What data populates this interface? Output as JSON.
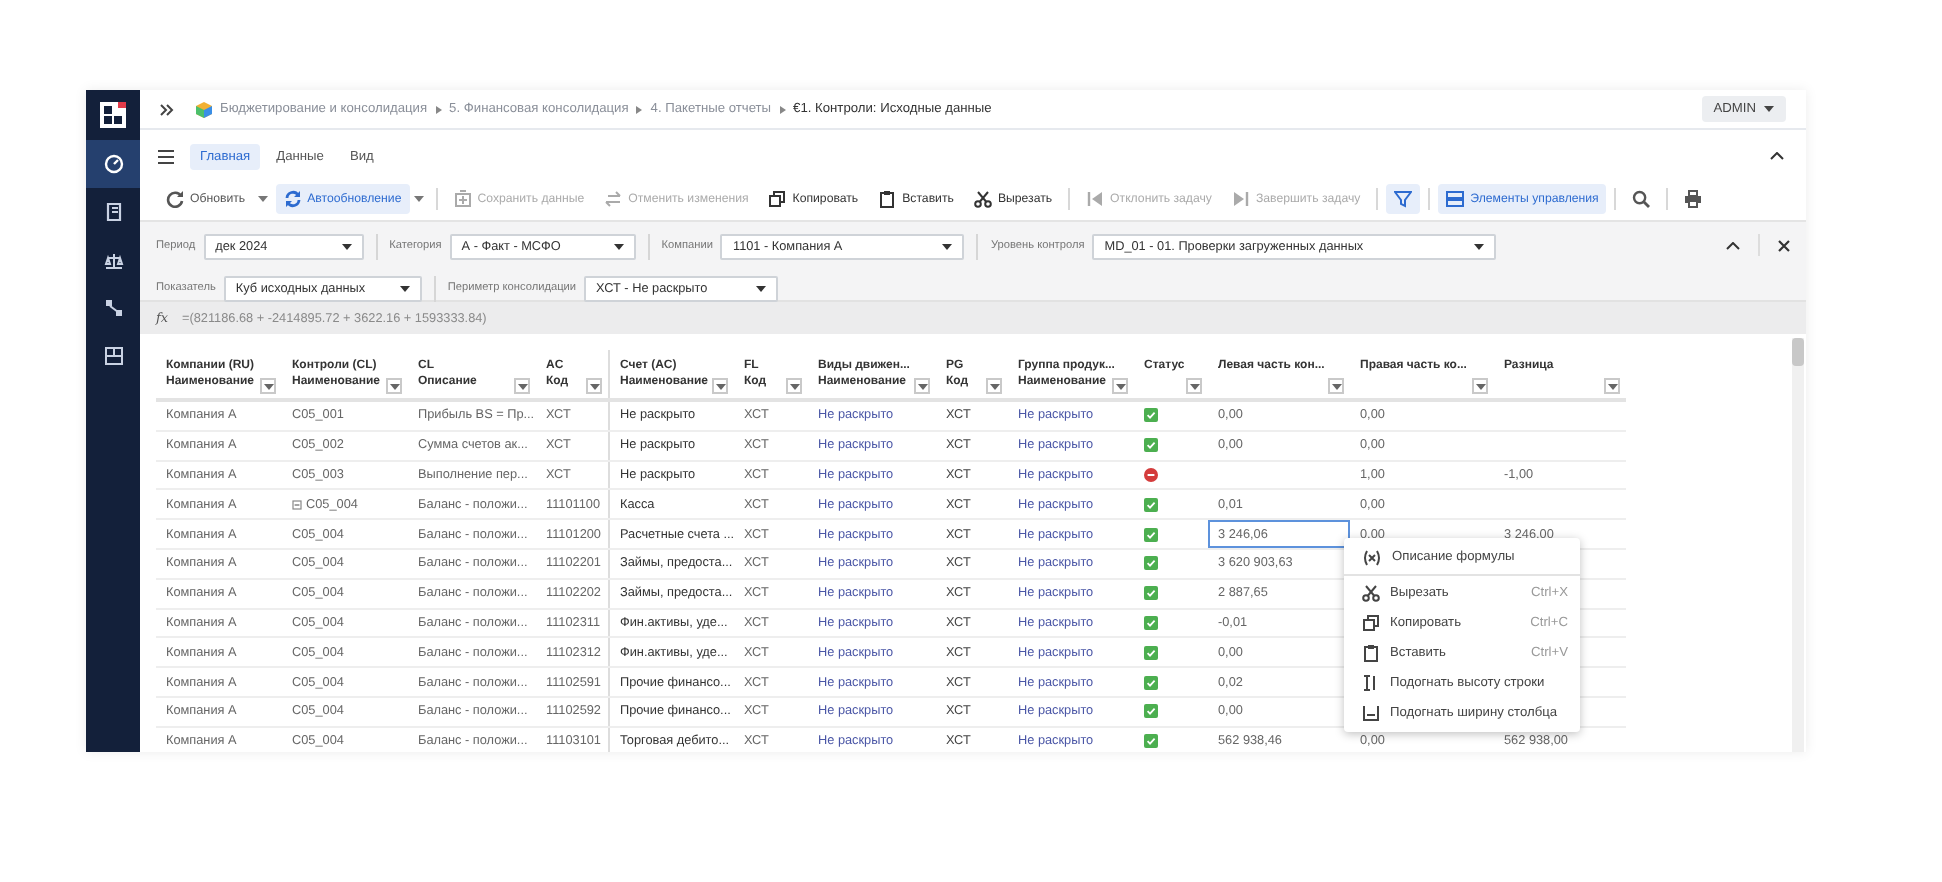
{
  "sidebar": {
    "items": [
      {
        "kind": "gauge",
        "selected": true
      },
      {
        "kind": "book",
        "selected": false
      },
      {
        "kind": "scale",
        "selected": false
      },
      {
        "kind": "network",
        "selected": false
      },
      {
        "kind": "dashboard",
        "selected": false
      }
    ]
  },
  "breadcrumb": [
    {
      "label": "Бюджетирование и консолидация",
      "current": false
    },
    {
      "label": "5. Финансовая консолидация",
      "current": false
    },
    {
      "label": "4. Пакетные отчеты",
      "current": false
    },
    {
      "label": "€1. Контроли: Исходные данные",
      "current": true
    }
  ],
  "user_menu": {
    "label": "ADMIN"
  },
  "ribbon_tabs": [
    {
      "label": "Главная",
      "selected": true
    },
    {
      "label": "Данные",
      "selected": false
    },
    {
      "label": "Вид",
      "selected": false
    }
  ],
  "toolbar": [
    {
      "kind": "refresh",
      "label": "Обновить",
      "dropdown": true,
      "active": false,
      "disabled": false
    },
    {
      "kind": "sync",
      "label": "Автообновление",
      "dropdown": true,
      "active": true,
      "disabled": false
    },
    {
      "kind": "separator"
    },
    {
      "kind": "save",
      "label": "Сохранить данные",
      "dropdown": false,
      "active": false,
      "disabled": true
    },
    {
      "kind": "undo",
      "label": "Отменить изменения",
      "dropdown": false,
      "active": false,
      "disabled": true
    },
    {
      "kind": "copy",
      "label": "Копировать",
      "dropdown": false,
      "active": false,
      "disabled": false
    },
    {
      "kind": "paste",
      "label": "Вставить",
      "dropdown": false,
      "active": false,
      "disabled": false
    },
    {
      "kind": "cut",
      "label": "Вырезать",
      "dropdown": false,
      "active": false,
      "disabled": false
    },
    {
      "kind": "separator"
    },
    {
      "kind": "reject",
      "label": "Отклонить задачу",
      "dropdown": false,
      "active": false,
      "disabled": true
    },
    {
      "kind": "complete",
      "label": "Завершить задачу",
      "dropdown": false,
      "active": false,
      "disabled": true
    },
    {
      "kind": "separator"
    },
    {
      "kind": "filter",
      "dropdown": false,
      "active": true,
      "disabled": false
    },
    {
      "kind": "separator"
    },
    {
      "kind": "controls",
      "label": "Элементы управления",
      "dropdown": false,
      "active": true,
      "disabled": false
    },
    {
      "kind": "separator"
    },
    {
      "kind": "search",
      "dropdown": false,
      "active": false,
      "disabled": false
    },
    {
      "kind": "separator"
    },
    {
      "kind": "print",
      "dropdown": false,
      "active": false,
      "disabled": false
    }
  ],
  "filters": [
    [
      {
        "label": "Период",
        "value": "дек 2024"
      },
      {
        "label": "Категория",
        "value": "А - Факт - МСФО"
      },
      {
        "label": "Компании",
        "value": "1101 - Компания А"
      },
      {
        "label": "Уровень контроля",
        "value": "MD_01 - 01. Проверки загруженных данных"
      }
    ],
    [
      {
        "label": "Показатель",
        "value": "Куб исходных данных"
      },
      {
        "label": "Периметр консолидации",
        "value": "ХСТ - Не раскрыто"
      }
    ]
  ],
  "formula": {
    "label": "fx",
    "value": "=(821186.68 + -2414895.72 + 3622.16 + 1593333.84)"
  },
  "table": {
    "columns": [
      {
        "label": "Компании (RU)\nНаименование",
        "kind": "text"
      },
      {
        "label": "Контроли (CL)\nНаименование",
        "kind": "text"
      },
      {
        "label": "CL\nОписание",
        "kind": "text"
      },
      {
        "label": "AC\nКод",
        "kind": "text"
      },
      {
        "label": "Счет (AC)\nНаименование",
        "kind": "account"
      },
      {
        "label": "FL\nКод",
        "kind": "text"
      },
      {
        "label": "Виды движен...\nНаименование",
        "kind": "link"
      },
      {
        "label": "PG\nКод",
        "kind": "code"
      },
      {
        "label": "Группа продук...\nНаименование",
        "kind": "link"
      },
      {
        "label": "Статус",
        "kind": "status"
      },
      {
        "label": "Левая часть кон...",
        "kind": "amount"
      },
      {
        "label": "Правая часть ко...",
        "kind": "amount"
      },
      {
        "label": "Разница",
        "kind": "amount"
      }
    ],
    "rows": [
      {
        "selected": false,
        "status_ok": true,
        "cells": [
          "Компания А",
          "C05_001",
          "Прибыль BS = Пр...",
          "ХСТ",
          "Не раскрыто",
          "ХСТ",
          "Не раскрыто",
          "ХСТ",
          "Не раскрыто",
          null,
          "0,00",
          "0,00",
          null
        ]
      },
      {
        "selected": false,
        "status_ok": true,
        "cells": [
          "Компания А",
          "C05_002",
          "Сумма счетов ак...",
          "ХСТ",
          "Не раскрыто",
          "ХСТ",
          "Не раскрыто",
          "ХСТ",
          "Не раскрыто",
          null,
          "0,00",
          "0,00",
          null
        ]
      },
      {
        "selected": false,
        "status_ok": false,
        "cells": [
          "Компания А",
          "C05_003",
          "Выполнение пер...",
          "ХСТ",
          "Не раскрыто",
          "ХСТ",
          "Не раскрыто",
          "ХСТ",
          "Не раскрыто",
          null,
          null,
          "1,00",
          "-1,00"
        ]
      },
      {
        "selected": false,
        "status_ok": true,
        "expanded": true,
        "cells": [
          "Компания А",
          "C05_004",
          "Баланс - положи...",
          "11101100",
          "Касса",
          "ХСТ",
          "Не раскрыто",
          "ХСТ",
          "Не раскрыто",
          null,
          "0,01",
          "0,00",
          null
        ]
      },
      {
        "selected": true,
        "status_ok": true,
        "cells": [
          "Компания А",
          "C05_004",
          "Баланс - положи...",
          "11101200",
          "Расчетные счета ...",
          "ХСТ",
          "Не раскрыто",
          "ХСТ",
          "Не раскрыто",
          null,
          "3 246,06",
          "0,00",
          "3 246,00"
        ]
      },
      {
        "selected": false,
        "status_ok": true,
        "cells": [
          "Компания А",
          "C05_004",
          "Баланс - положи...",
          "11102201",
          "Займы, предоста...",
          "ХСТ",
          "Не раскрыто",
          "ХСТ",
          "Не раскрыто",
          null,
          "3 620 903,63",
          null,
          null
        ]
      },
      {
        "selected": false,
        "status_ok": true,
        "cells": [
          "Компания А",
          "C05_004",
          "Баланс - положи...",
          "11102202",
          "Займы, предоста...",
          "ХСТ",
          "Не раскрыто",
          "ХСТ",
          "Не раскрыто",
          null,
          "2 887,65",
          null,
          null
        ]
      },
      {
        "selected": false,
        "status_ok": true,
        "cells": [
          "Компания А",
          "C05_004",
          "Баланс - положи...",
          "11102311",
          "Фин.активы, уде...",
          "ХСТ",
          "Не раскрыто",
          "ХСТ",
          "Не раскрыто",
          null,
          "-0,01",
          null,
          null
        ]
      },
      {
        "selected": false,
        "status_ok": true,
        "cells": [
          "Компания А",
          "C05_004",
          "Баланс - положи...",
          "11102312",
          "Фин.активы, уде...",
          "ХСТ",
          "Не раскрыто",
          "ХСТ",
          "Не раскрыто",
          null,
          "0,00",
          null,
          null
        ]
      },
      {
        "selected": false,
        "status_ok": true,
        "cells": [
          "Компания А",
          "C05_004",
          "Баланс - положи...",
          "11102591",
          "Прочие финансо...",
          "ХСТ",
          "Не раскрыто",
          "ХСТ",
          "Не раскрыто",
          null,
          "0,02",
          null,
          null
        ]
      },
      {
        "selected": false,
        "status_ok": true,
        "cells": [
          "Компания А",
          "C05_004",
          "Баланс - положи...",
          "11102592",
          "Прочие финансо...",
          "ХСТ",
          "Не раскрыто",
          "ХСТ",
          "Не раскрыто",
          null,
          "0,00",
          null,
          null
        ]
      },
      {
        "selected": false,
        "status_ok": true,
        "cells": [
          "Компания А",
          "C05_004",
          "Баланс - положи...",
          "11103101",
          "Торговая дебито...",
          "ХСТ",
          "Не раскрыто",
          "ХСТ",
          "Не раскрыто",
          null,
          "562 938,46",
          "0,00",
          "562 938,00"
        ]
      }
    ]
  },
  "context_menu": [
    {
      "kind": "formula",
      "label": "Описание формулы",
      "divider_after": true
    },
    {
      "kind": "cut",
      "label": "Вырезать",
      "shortcut": "Ctrl+X",
      "divider_after": false
    },
    {
      "kind": "copy",
      "label": "Копировать",
      "shortcut": "Ctrl+C",
      "divider_after": false
    },
    {
      "kind": "paste",
      "label": "Вставить",
      "shortcut": "Ctrl+V",
      "divider_after": false
    },
    {
      "kind": "row-height",
      "label": "Подогнать высоту строки",
      "divider_after": false
    },
    {
      "kind": "col-width",
      "label": "Подогнать ширину столбца",
      "divider_after": false
    }
  ]
}
